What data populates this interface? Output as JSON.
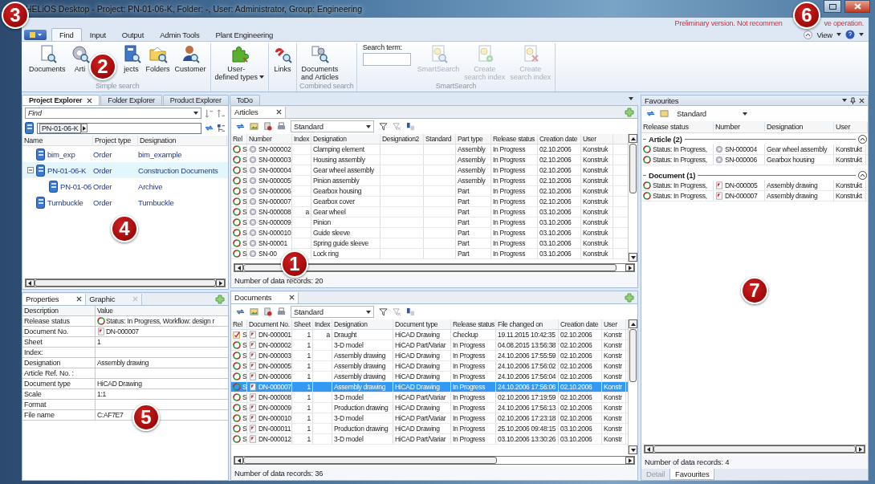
{
  "window": {
    "title": "HELiOS Desktop - Project: PN-01-06-K, Folder: -, User: Administrator, Group: Engineering"
  },
  "notice": [
    "Preliminary version. Not recommen",
    "ve operation."
  ],
  "ribbon": {
    "tabs": [
      {
        "label": "Find",
        "selected": true
      },
      {
        "label": "Input",
        "selected": false
      },
      {
        "label": "Output",
        "selected": false
      },
      {
        "label": "Admin Tools",
        "selected": false
      },
      {
        "label": "Plant Engineering",
        "selected": false
      }
    ],
    "view_menu": "View",
    "groups": [
      {
        "title": "Simple search",
        "items": [
          {
            "kind": "button",
            "label": "Documents",
            "disabled": false
          },
          {
            "kind": "button",
            "label": "Arti",
            "disabled": false
          },
          {
            "kind": "button",
            "label": "jects",
            "disabled": false
          },
          {
            "kind": "button",
            "label": "Folders",
            "disabled": false
          },
          {
            "kind": "button",
            "label": "Customer",
            "disabled": false
          }
        ]
      },
      {
        "items": [
          {
            "kind": "button",
            "label": "User-\ndefined types",
            "disabled": false,
            "dropdown": true
          }
        ]
      },
      {
        "items": [
          {
            "kind": "button",
            "label": "Links",
            "disabled": false
          }
        ]
      },
      {
        "title": "Combined search",
        "items": [
          {
            "kind": "button",
            "label": "Documents\nand Articles",
            "disabled": false
          }
        ]
      },
      {
        "title": "SmartSearch",
        "items": [
          {
            "kind": "search",
            "label": "Search term:"
          },
          {
            "kind": "button",
            "label": "SmartSearch",
            "disabled": true
          },
          {
            "kind": "button",
            "label": "Create\nsearch index",
            "disabled": true
          },
          {
            "kind": "button",
            "label": "Create\nsearch index",
            "disabled": true
          }
        ]
      }
    ]
  },
  "explorer_tabs": [
    {
      "label": "Project Explorer",
      "selected": true,
      "closable": true
    },
    {
      "label": "Folder Explorer",
      "selected": false,
      "closable": false
    },
    {
      "label": "Product Explorer",
      "selected": false,
      "closable": false
    },
    {
      "label": "ToDo",
      "selected": false,
      "closable": false
    }
  ],
  "project_explorer": {
    "find_placeholder": "Find",
    "path": "PN-01-06-K",
    "columns": [
      "Name",
      "Project type",
      "Designation"
    ],
    "tree": [
      {
        "name": "bim_exp",
        "type": "Order",
        "designation": "bim_example",
        "selected": false
      },
      {
        "name": "PN-01-06-K",
        "type": "Order",
        "designation": "Construction Documents",
        "selected": true,
        "expanded": true,
        "children": [
          {
            "name": "PN-01-06",
            "type": "Order",
            "designation": "Archive",
            "selected": false
          }
        ]
      },
      {
        "name": "Turnbuckle",
        "type": "Order",
        "designation": "Turnbuckle",
        "selected": false
      }
    ]
  },
  "properties": {
    "tabs": [
      {
        "label": "Properties",
        "selected": true
      },
      {
        "label": "Graphic",
        "selected": false
      }
    ],
    "columns": [
      "Description",
      "Value"
    ],
    "rows": [
      {
        "label": "Release status",
        "value": "Status: In Progress, Workflow: design r",
        "kind": "status"
      },
      {
        "label": "Document No.",
        "value": "DN-000007",
        "kind": "document"
      },
      {
        "label": "Sheet",
        "value": "1"
      },
      {
        "label": "Index:"
      },
      {
        "label": "Designation",
        "value": "Assembly drawing"
      },
      {
        "label": "Article Ref. No. :"
      },
      {
        "label": "Document type",
        "value": "HiCAD Drawing"
      },
      {
        "label": "Scale",
        "value": "1:1"
      },
      {
        "label": "Format"
      },
      {
        "label": "File name",
        "value": "C:AF7E7"
      }
    ]
  },
  "articles": {
    "tab": "Articles",
    "view": "Standard",
    "columns": [
      "Rel",
      "Number",
      "Index",
      "Designation",
      "Designation2",
      "Standard",
      "Part type",
      "Release status",
      "Creation date",
      "User"
    ],
    "rows": [
      {
        "kind": "status",
        "rel": "S",
        "number": "SN-000002",
        "designation": "Clamping element",
        "part_type": "Assembly",
        "release": "In Progress",
        "created": "02.10.2006",
        "user": "Konstruk"
      },
      {
        "kind": "status",
        "rel": "S",
        "number": "SN-000003",
        "designation": "Housing assembly",
        "part_type": "Assembly",
        "release": "In Progress",
        "created": "02.10.2006",
        "user": "Konstruk"
      },
      {
        "kind": "status",
        "rel": "S",
        "number": "SN-000004",
        "designation": "Gear wheel assembly",
        "part_type": "Assembly",
        "release": "In Progress",
        "created": "02.10.2006",
        "user": "Konstruk"
      },
      {
        "kind": "status",
        "rel": "S",
        "number": "SN-000005",
        "designation": "Pinion assembly",
        "part_type": "Assembly",
        "release": "In Progress",
        "created": "02.10.2006",
        "user": "Konstruk"
      },
      {
        "kind": "status",
        "rel": "S",
        "number": "SN-000006",
        "designation": "Gearbox housing",
        "part_type": "Part",
        "release": "In Progress",
        "created": "02.10.2006",
        "user": "Konstruk"
      },
      {
        "kind": "status",
        "rel": "S",
        "number": "SN-000007",
        "designation": "Gearbox cover",
        "part_type": "Part",
        "release": "In Progress",
        "created": "02.10.2006",
        "user": "Konstruk"
      },
      {
        "kind": "status",
        "rel": "S",
        "number": "SN-000008",
        "index": "a",
        "designation": "Gear wheel",
        "part_type": "Part",
        "release": "In Progress",
        "created": "03.10.2006",
        "user": "Konstruk"
      },
      {
        "kind": "status",
        "rel": "S",
        "number": "SN-000009",
        "designation": "Pinion",
        "part_type": "Part",
        "release": "In Progress",
        "created": "03.10.2006",
        "user": "Konstruk"
      },
      {
        "kind": "status",
        "rel": "S",
        "number": "SN-000010",
        "designation": "Guide sleeve",
        "part_type": "Part",
        "release": "In Progress",
        "created": "03.10.2006",
        "user": "Konstruk"
      },
      {
        "kind": "status",
        "rel": "S",
        "number": "SN-00001",
        "designation": "Spring guide sleeve",
        "part_type": "Part",
        "release": "In Progress",
        "created": "03.10.2006",
        "user": "Konstruk"
      },
      {
        "kind": "status",
        "rel": "S",
        "number": "SN-00",
        "designation": "Lock ring",
        "part_type": "Part",
        "release": "In Progress",
        "created": "03.10.2006",
        "user": "Konstruk"
      }
    ],
    "count": "Number of data records: 20"
  },
  "documents": {
    "tab": "Documents",
    "view": "Standard",
    "columns": [
      "Rel",
      "Document No.",
      "Sheet",
      "Index",
      "Designation",
      "Document type",
      "Release status",
      "File changed on",
      "Creation date",
      "User"
    ],
    "rows": [
      {
        "kind": "checkup",
        "rel": "S",
        "number": "DN-000001",
        "sheet": "1",
        "index": "a",
        "designation": "Draught",
        "doc_type": "HiCAD Drawing",
        "release": "Checkup",
        "changed": "19.11.2015 10:42:35",
        "created": "02.10.2006",
        "user": "Konstr",
        "selected": false
      },
      {
        "kind": "status",
        "rel": "S",
        "number": "DN-000002",
        "sheet": "1",
        "designation": "3-D model",
        "doc_type": "HiCAD Part/Variar",
        "release": "In Progress",
        "changed": "04.08.2015 13:56:38",
        "created": "02.10.2006",
        "user": "Konstr",
        "selected": false
      },
      {
        "kind": "status",
        "rel": "S",
        "number": "DN-000003",
        "sheet": "1",
        "designation": "Assembly drawing",
        "doc_type": "HiCAD Drawing",
        "release": "In Progress",
        "changed": "24.10.2006 17:55:59",
        "created": "02.10.2006",
        "user": "Konstr",
        "selected": false
      },
      {
        "kind": "status",
        "rel": "S",
        "number": "DN-000005",
        "sheet": "1",
        "designation": "Assembly drawing",
        "doc_type": "HiCAD Drawing",
        "release": "In Progress",
        "changed": "24.10.2006 17:56:02",
        "created": "02.10.2006",
        "user": "Konstr",
        "selected": false
      },
      {
        "kind": "status",
        "rel": "S",
        "number": "DN-000006",
        "sheet": "1",
        "designation": "Assembly drawing",
        "doc_type": "HiCAD Drawing",
        "release": "In Progress",
        "changed": "24.10.2006 17:56:04",
        "created": "02.10.2006",
        "user": "Konstr",
        "selected": false
      },
      {
        "kind": "status",
        "rel": "S",
        "number": "DN-000007",
        "sheet": "1",
        "designation": "Assembly drawing",
        "doc_type": "HiCAD Drawing",
        "release": "In Progress",
        "changed": "24.10.2006 17:56:06",
        "created": "02.10.2006",
        "user": "Konstr",
        "selected": true
      },
      {
        "kind": "status",
        "rel": "S",
        "number": "DN-000008",
        "sheet": "1",
        "designation": "3-D model",
        "doc_type": "HiCAD Part/Variar",
        "release": "In Progress",
        "changed": "02.10.2006 17:19:59",
        "created": "02.10.2006",
        "user": "Konstr",
        "selected": false
      },
      {
        "kind": "status",
        "rel": "S",
        "number": "DN-000009",
        "sheet": "1",
        "designation": "Production drawing",
        "doc_type": "HiCAD Drawing",
        "release": "In Progress",
        "changed": "24.10.2006 17:56:13",
        "created": "02.10.2006",
        "user": "Konstr",
        "selected": false
      },
      {
        "kind": "status",
        "rel": "S",
        "number": "DN-000010",
        "sheet": "1",
        "designation": "3-D model",
        "doc_type": "HiCAD Part/Variar",
        "release": "In Progress",
        "changed": "02.10.2006 17:23:18",
        "created": "02.10.2006",
        "user": "Konstr",
        "selected": false
      },
      {
        "kind": "status",
        "rel": "S",
        "number": "DN-000011",
        "sheet": "1",
        "designation": "Production drawing",
        "doc_type": "HiCAD Drawing",
        "release": "In Progress",
        "changed": "25.10.2006 09:48:15",
        "created": "03.10.2006",
        "user": "Konstr",
        "selected": false
      },
      {
        "kind": "status",
        "rel": "S",
        "number": "DN-000012",
        "sheet": "1",
        "designation": "3-D model",
        "doc_type": "HiCAD Part/Variar",
        "release": "In Progress",
        "changed": "03.10.2006 13:30:26",
        "created": "03.10.2006",
        "user": "Konstr",
        "selected": false
      }
    ],
    "count": "Number of data records: 36"
  },
  "favourites": {
    "title": "Favourites",
    "view": "Standard",
    "columns": [
      "Release status",
      "Number",
      "Designation",
      "User"
    ],
    "groups": [
      {
        "title": "Article (2)",
        "expanded": true,
        "rows": [
          {
            "status": "Status: In Progress,",
            "kind": "article",
            "number": "SN-000004",
            "designation": "Gear wheel assembly",
            "user": "Konstrukt"
          },
          {
            "status": "Status: In Progress,",
            "kind": "article",
            "number": "SN-000006",
            "designation": "Gearbox housing",
            "user": "Konstrukt"
          }
        ]
      },
      {
        "title": "Document (1)",
        "expanded": true,
        "rows": [
          {
            "status": "Status: In Progress,",
            "kind": "document",
            "number": "DN-000005",
            "designation": "Assembly drawing",
            "user": "Konstrukt"
          },
          {
            "status": "Status: In Progress,",
            "kind": "document",
            "number": "DN-000007",
            "designation": "Assembly drawing",
            "user": "Konstrukt"
          }
        ]
      }
    ],
    "count": "Number of data records: 4",
    "bottom_tabs": [
      {
        "label": "Detail",
        "selected": false
      },
      {
        "label": "Favourites",
        "selected": true
      }
    ]
  },
  "callouts": [
    "1",
    "2",
    "3",
    "4",
    "5",
    "6",
    "7"
  ]
}
